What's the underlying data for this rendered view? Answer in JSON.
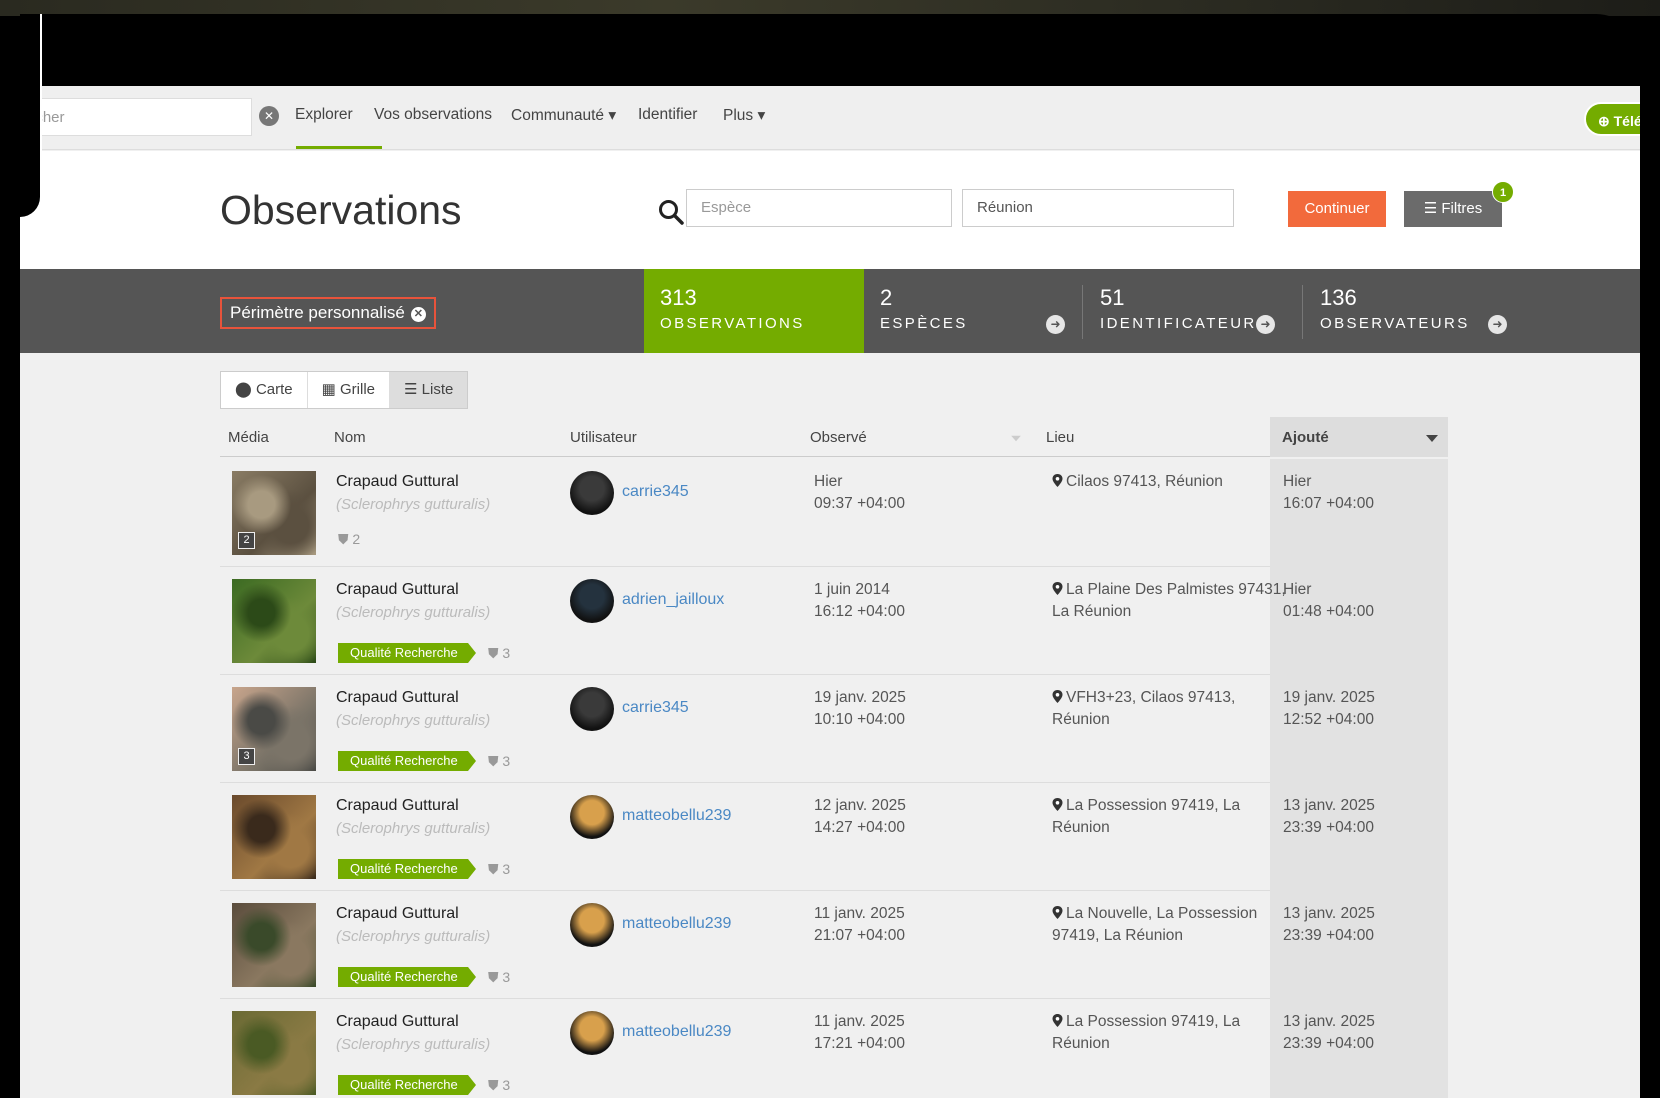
{
  "nav": {
    "search_value": "ercher",
    "items": [
      "Explorer",
      "Vos observations",
      "Communauté ▾",
      "Identifier",
      "Plus ▾"
    ],
    "upload_label": "Télé"
  },
  "header": {
    "title": "Observations",
    "species_placeholder": "Espèce",
    "place_value": "Réunion",
    "continue_label": "Continuer",
    "filters_label": "Filtres",
    "filters_badge": "1"
  },
  "stats": {
    "place_chip": "Périmètre personnalisé",
    "items": [
      {
        "num": "313",
        "label": "OBSERVATIONS"
      },
      {
        "num": "2",
        "label": "ESPÈCES"
      },
      {
        "num": "51",
        "label": "IDENTIFICATEURS"
      },
      {
        "num": "136",
        "label": "OBSERVATEURS"
      }
    ]
  },
  "view_toggle": [
    "Carte",
    "Grille",
    "Liste"
  ],
  "table": {
    "headers": [
      "Média",
      "Nom",
      "Utilisateur",
      "Observé",
      "Lieu",
      "Ajouté"
    ],
    "rows": [
      {
        "name": "Crapaud Guttural",
        "sci": "(Sclerophrys gutturalis)",
        "badge": "",
        "ids": "2",
        "photo_count": "2",
        "user": "carrie345",
        "observed": [
          "Hier",
          "09:37 +04:00"
        ],
        "place": [
          "Cilaos 97413, Réunion",
          ""
        ],
        "added": [
          "Hier",
          "16:07 +04:00"
        ]
      },
      {
        "name": "Crapaud Guttural",
        "sci": "(Sclerophrys gutturalis)",
        "badge": "Qualité Recherche",
        "ids": "3",
        "photo_count": "",
        "user": "adrien_jailloux",
        "observed": [
          "1 juin 2014",
          "16:12 +04:00"
        ],
        "place": [
          "La Plaine Des Palmistes 97431,",
          "La Réunion"
        ],
        "added": [
          "Hier",
          "01:48 +04:00"
        ]
      },
      {
        "name": "Crapaud Guttural",
        "sci": "(Sclerophrys gutturalis)",
        "badge": "Qualité Recherche",
        "ids": "3",
        "photo_count": "3",
        "user": "carrie345",
        "observed": [
          "19 janv. 2025",
          "10:10 +04:00"
        ],
        "place": [
          "VFH3+23, Cilaos 97413,",
          "Réunion"
        ],
        "added": [
          "19 janv. 2025",
          "12:52 +04:00"
        ]
      },
      {
        "name": "Crapaud Guttural",
        "sci": "(Sclerophrys gutturalis)",
        "badge": "Qualité Recherche",
        "ids": "3",
        "photo_count": "",
        "user": "matteobellu239",
        "observed": [
          "12 janv. 2025",
          "14:27 +04:00"
        ],
        "place": [
          "La Possession 97419, La",
          "Réunion"
        ],
        "added": [
          "13 janv. 2025",
          "23:39 +04:00"
        ]
      },
      {
        "name": "Crapaud Guttural",
        "sci": "(Sclerophrys gutturalis)",
        "badge": "Qualité Recherche",
        "ids": "3",
        "photo_count": "",
        "user": "matteobellu239",
        "observed": [
          "11 janv. 2025",
          "21:07 +04:00"
        ],
        "place": [
          "La Nouvelle, La Possession",
          "97419, La Réunion"
        ],
        "added": [
          "13 janv. 2025",
          "23:39 +04:00"
        ]
      },
      {
        "name": "Crapaud Guttural",
        "sci": "(Sclerophrys gutturalis)",
        "badge": "Qualité Recherche",
        "ids": "3",
        "photo_count": "",
        "user": "matteobellu239",
        "observed": [
          "11 janv. 2025",
          "17:21 +04:00"
        ],
        "place": [
          "La Possession 97419, La",
          "Réunion"
        ],
        "added": [
          "13 janv. 2025",
          "23:39 +04:00"
        ]
      }
    ]
  },
  "colors": {
    "brand_green": "#74ac00",
    "accent_orange": "#f26a3c",
    "stats_bg": "#555555",
    "link_blue": "#4a88c4"
  }
}
